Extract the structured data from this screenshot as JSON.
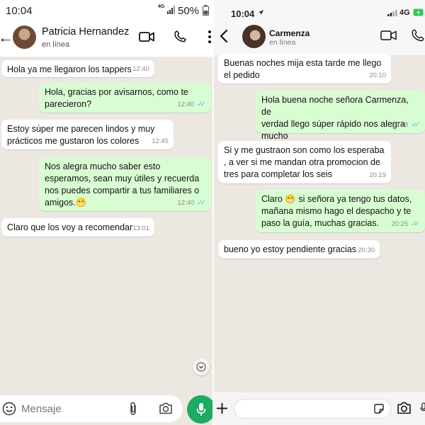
{
  "left": {
    "status": {
      "time": "10:04",
      "network": "4G",
      "battery": "50%"
    },
    "header": {
      "name": "Patricia Hernandez",
      "status": "en línea"
    },
    "messages": [
      {
        "dir": "in",
        "text": "Hola ya me llegaron los tappers",
        "time": "12:40"
      },
      {
        "dir": "out",
        "text": "Hola, gracias por avisarnos, como te\nparecieron?",
        "time": "12:40"
      },
      {
        "dir": "in",
        "text": "Estoy súper me parecen lindos y muy\nprácticos me gustaron los colores",
        "time": "12:45"
      },
      {
        "dir": "out",
        "text": "Nos alegra mucho saber esto\nesperamos, sean muy útiles y recuerda\nnos puedes compartir a tus familiares o\namigos.😁",
        "time": "12:40"
      },
      {
        "dir": "in",
        "text": "Claro que los voy a recomendar",
        "time": "13:01"
      }
    ],
    "input": {
      "placeholder": "Mensaje"
    }
  },
  "right": {
    "status": {
      "time": "10:04",
      "network": "4G"
    },
    "header": {
      "name": "Carmenza",
      "status": "en línea"
    },
    "messages": [
      {
        "dir": "in",
        "text": "Buenas noches mija esta tarde me llego\nel pedido",
        "time": "20:10"
      },
      {
        "dir": "out",
        "text": "Hola buena noche señora Carmenza, de\nverdad llego súper rápido nos alegra\nmucho",
        "time": "20:18"
      },
      {
        "dir": "in",
        "text": "Si y me gustraon son como los esperaba\n, a ver si me mandan otra promocion de\ntres para completar los seis",
        "time": "20:19"
      },
      {
        "dir": "out",
        "text": "Claro 😁 si señora ya tengo tus datos,\nmañana mismo hago el despacho y te\npaso la guía, muchas gracias.",
        "time": "20:25"
      },
      {
        "dir": "in",
        "text": "bueno yo estoy pendiente gracias",
        "time": "20:30"
      }
    ]
  },
  "colors": {
    "incoming": "#ffffff",
    "outgoing": "#d9fdd3",
    "accent": "#25d366",
    "ticks": "#53bdeb"
  },
  "icons": [
    "back-arrow-icon",
    "video-call-icon",
    "phone-icon",
    "more-vert-icon",
    "emoji-icon",
    "attach-icon",
    "camera-icon",
    "mic-icon",
    "scroll-down-icon",
    "plus-icon",
    "sticker-icon",
    "location-arrow-icon",
    "signal-icon",
    "battery-icon"
  ]
}
